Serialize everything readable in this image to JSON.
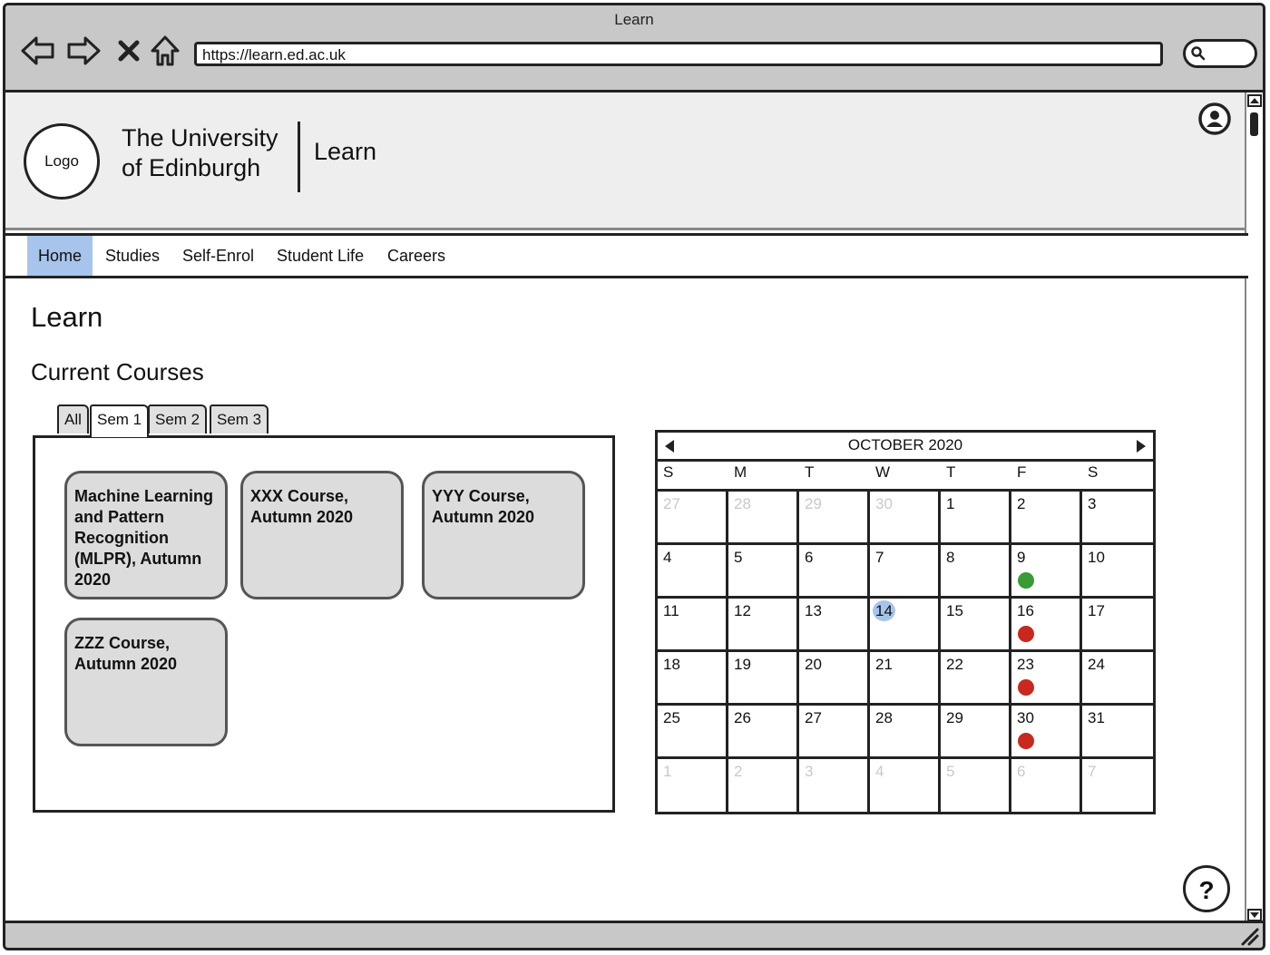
{
  "window": {
    "title": "Learn"
  },
  "browser": {
    "url": "https://learn.ed.ac.uk"
  },
  "header": {
    "logo": "Logo",
    "university_line1": "The University",
    "university_line2": "of Edinburgh",
    "site_name": "Learn"
  },
  "nav": {
    "items": [
      "Home",
      "Studies",
      "Self-Enrol",
      "Student Life",
      "Careers"
    ],
    "active": "Home"
  },
  "page": {
    "title": "Learn",
    "section": "Current Courses"
  },
  "tabs": {
    "items": [
      "All",
      "Sem 1",
      "Sem 2",
      "Sem 3"
    ],
    "active": "Sem 1"
  },
  "courses": [
    "Machine Learning and Pattern Recognition (MLPR), Autumn 2020",
    "XXX Course, Autumn 2020",
    "YYY Course, Autumn 2020",
    "ZZZ Course, Autumn 2020"
  ],
  "calendar": {
    "title": "OCTOBER 2020",
    "weekdays": [
      "S",
      "M",
      "T",
      "W",
      "T",
      "F",
      "S"
    ],
    "weeks": [
      [
        "27",
        "28",
        "29",
        "30",
        "1",
        "2",
        "3"
      ],
      [
        "4",
        "5",
        "6",
        "7",
        "8",
        "9",
        "10"
      ],
      [
        "11",
        "12",
        "13",
        "14",
        "15",
        "16",
        "17"
      ],
      [
        "18",
        "19",
        "20",
        "21",
        "22",
        "23",
        "24"
      ],
      [
        "25",
        "26",
        "27",
        "28",
        "29",
        "30",
        "31"
      ],
      [
        "1",
        "2",
        "3",
        "4",
        "5",
        "6",
        "7"
      ]
    ],
    "today": "14",
    "events": [
      {
        "day": "9",
        "color": "#3a9a33"
      },
      {
        "day": "16",
        "color": "#c8281e"
      },
      {
        "day": "23",
        "color": "#c8281e"
      },
      {
        "day": "30",
        "color": "#c8281e"
      }
    ],
    "highlight_color": "#a7c4ec"
  },
  "help": {
    "label": "?"
  }
}
